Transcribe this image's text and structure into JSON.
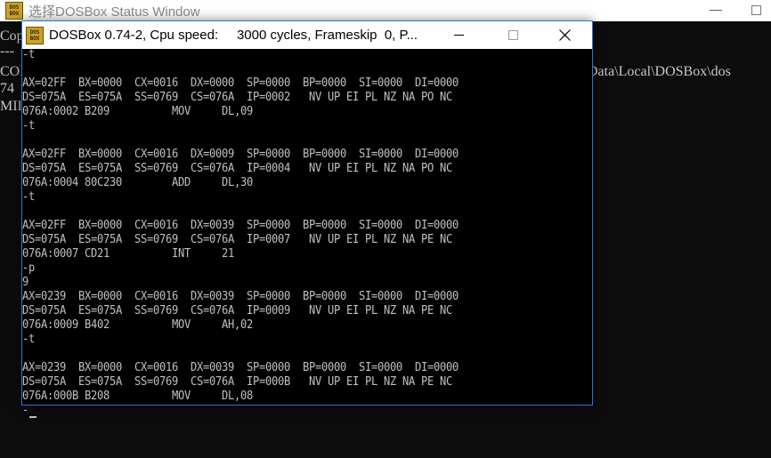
{
  "status_window": {
    "title": "选择DOSBox Status Window",
    "minimize_glyph": "—",
    "lines": [
      "Cop",
      "---",
      "COM",
      "74",
      "MII"
    ],
    "path_fragment": "Data\\Local\\DOSBox\\dos"
  },
  "dosbox": {
    "logo_top": "DOS",
    "logo_bottom": "BOX",
    "title": "DOSBox 0.74-2, Cpu speed:     3000 cycles, Frameskip  0, P...",
    "lines": [
      "-t",
      "",
      "AX=02FF  BX=0000  CX=0016  DX=0000  SP=0000  BP=0000  SI=0000  DI=0000",
      "DS=075A  ES=075A  SS=0769  CS=076A  IP=0002   NV UP EI PL NZ NA PO NC",
      "076A:0002 B209          MOV     DL,09",
      "-t",
      "",
      "AX=02FF  BX=0000  CX=0016  DX=0009  SP=0000  BP=0000  SI=0000  DI=0000",
      "DS=075A  ES=075A  SS=0769  CS=076A  IP=0004   NV UP EI PL NZ NA PO NC",
      "076A:0004 80C230        ADD     DL,30",
      "-t",
      "",
      "AX=02FF  BX=0000  CX=0016  DX=0039  SP=0000  BP=0000  SI=0000  DI=0000",
      "DS=075A  ES=075A  SS=0769  CS=076A  IP=0007   NV UP EI PL NZ NA PE NC",
      "076A:0007 CD21          INT     21",
      "-p",
      "9",
      "AX=0239  BX=0000  CX=0016  DX=0039  SP=0000  BP=0000  SI=0000  DI=0000",
      "DS=075A  ES=075A  SS=0769  CS=076A  IP=0009   NV UP EI PL NZ NA PE NC",
      "076A:0009 B402          MOV     AH,02",
      "-t",
      "",
      "AX=0239  BX=0000  CX=0016  DX=0039  SP=0000  BP=0000  SI=0000  DI=0000",
      "DS=075A  ES=075A  SS=0769  CS=076A  IP=000B   NV UP EI PL NZ NA PE NC",
      "076A:000B B208          MOV     DL,08",
      "-"
    ]
  },
  "colors": {
    "console_text": "#c0c0c0",
    "console_bg": "#000000",
    "window_border": "#2b78d0"
  }
}
